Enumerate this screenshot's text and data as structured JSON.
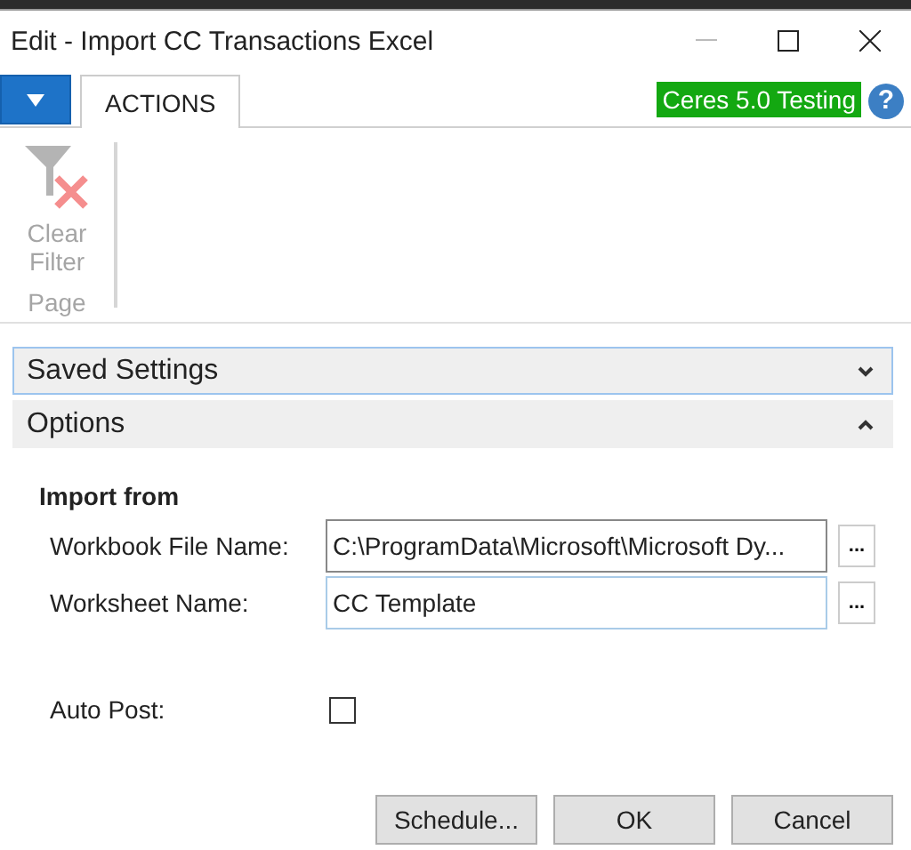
{
  "window": {
    "title": "Edit - Import CC Transactions Excel"
  },
  "tabs": [
    {
      "label": "ACTIONS",
      "selected": true
    }
  ],
  "environment_badge": "Ceres 5.0 Testing",
  "help": "?",
  "ribbon": {
    "groups": [
      {
        "label": "Page",
        "actions": [
          {
            "label": "Clear\nFilter",
            "disabled": true
          }
        ]
      }
    ]
  },
  "sections": [
    {
      "title": "Saved Settings",
      "expanded": false,
      "focused": true
    },
    {
      "title": "Options",
      "expanded": true,
      "focused": false
    }
  ],
  "options": {
    "group_title": "Import from",
    "fields": [
      {
        "label": "Workbook File Name:",
        "value": "C:\\ProgramData\\Microsoft\\Microsoft Dy...",
        "focused": false,
        "lookup": "..."
      },
      {
        "label": "Worksheet Name:",
        "value": "CC Template",
        "focused": true,
        "lookup": "..."
      }
    ],
    "auto_post": {
      "label": "Auto Post:",
      "checked": false
    }
  },
  "buttons": [
    "Schedule...",
    "OK",
    "Cancel"
  ]
}
